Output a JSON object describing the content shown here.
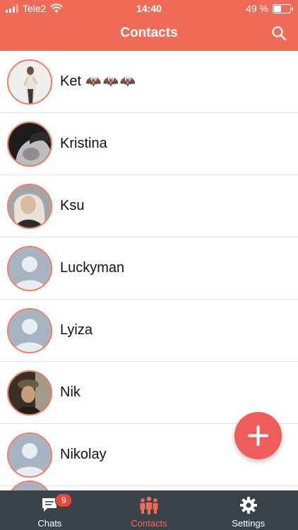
{
  "status_bar": {
    "carrier": "Tele2",
    "time": "14:40",
    "battery_text": "49 %",
    "battery_level": 0.49
  },
  "header": {
    "title": "Contacts"
  },
  "contacts": [
    {
      "name": "Ket",
      "decoration": "🦇🦇🦇",
      "avatar": "photo"
    },
    {
      "name": "Kristina",
      "avatar": "photo"
    },
    {
      "name": "Ksu",
      "avatar": "photo"
    },
    {
      "name": "Luckyman",
      "avatar": "placeholder"
    },
    {
      "name": "Lyiza",
      "avatar": "placeholder"
    },
    {
      "name": "Nik",
      "avatar": "photo"
    },
    {
      "name": "Nikolay",
      "avatar": "placeholder"
    }
  ],
  "tabs": [
    {
      "label": "Chats",
      "icon": "chat-icon",
      "badge": "9",
      "active": false
    },
    {
      "label": "Contacts",
      "icon": "contacts-icon",
      "active": true
    },
    {
      "label": "Settings",
      "icon": "gear-icon",
      "active": false
    }
  ],
  "colors": {
    "accent": "#ef6b58",
    "tabbar": "#3a4349",
    "fab": "#ee5c5c",
    "avatar_border": "#ef7a62"
  }
}
